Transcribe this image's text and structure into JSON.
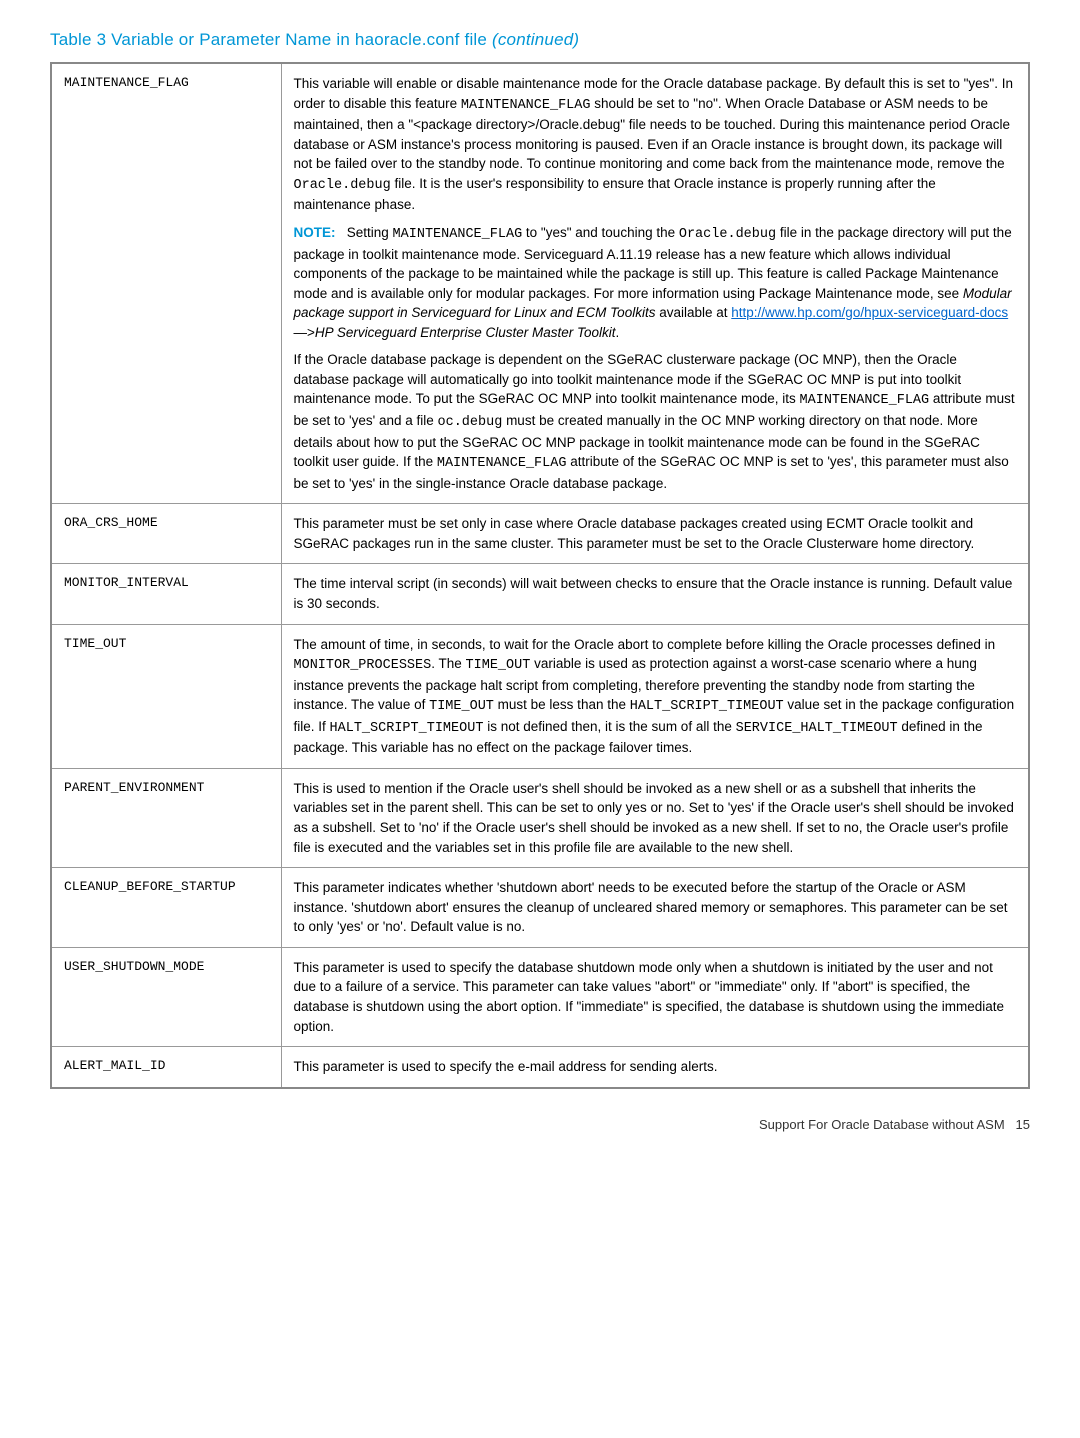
{
  "title_prefix": "Table 3 Variable or Parameter Name in haoracle.conf file ",
  "title_suffix": "(continued)",
  "rows": [
    {
      "param": "MAINTENANCE_FLAG",
      "para1_a": "This variable will enable or disable maintenance mode for the Oracle database package. By default this is set to \"yes\". In order to disable this feature ",
      "para1_b": "MAINTENANCE_FLAG",
      "para1_c": " should be set to \"no\". When Oracle Database or ASM needs to be maintained, then a \"<package directory>/Oracle.debug\" file needs to be touched. During this maintenance period Oracle database or ASM instance's process monitoring is paused. Even if an Oracle instance is brought down, its package will not be failed over to the standby node. To continue monitoring and come back from the maintenance mode, remove the ",
      "para1_d": "Oracle.debug",
      "para1_e": " file. It is the user's responsibility to ensure that Oracle instance is properly running after the maintenance phase.",
      "note_label": "NOTE:",
      "para2_a": "Setting ",
      "para2_b": "MAINTENANCE_FLAG",
      "para2_c": " to \"yes\" and touching the ",
      "para2_d": "Oracle.debug",
      "para2_e": " file in the package directory will put the package in toolkit maintenance mode. Serviceguard A.11.19 release has a new feature which allows individual components of the package to be maintained while the package is still up. This feature is called Package Maintenance mode and is available only for modular packages. For more information using Package Maintenance mode, see ",
      "para2_f": "Modular package support in Serviceguard for Linux and ECM Toolkits",
      "para2_g": " available at ",
      "link1": "http://www.hp.com/go/hpux-serviceguard-docs",
      "para2_h": " —>",
      "para2_i": "HP Serviceguard Enterprise Cluster Master Toolkit",
      "para2_j": ".",
      "para3_a": "If the Oracle database package is dependent on the SGeRAC clusterware package (OC MNP), then the Oracle database package will automatically go into toolkit maintenance mode if the SGeRAC OC MNP is put into toolkit maintenance mode. To put the SGeRAC OC MNP into toolkit maintenance mode, its ",
      "para3_b": "MAINTENANCE_FLAG",
      "para3_c": " attribute must be set to 'yes' and a file ",
      "para3_d": "oc.debug",
      "para3_e": " must be created manually in the OC MNP working directory on that node. More details about how to put the SGeRAC OC MNP package in toolkit maintenance mode can be found in the SGeRAC toolkit user guide. If the ",
      "para3_f": "MAINTENANCE_FLAG",
      "para3_g": " attribute of the SGeRAC OC MNP is set to 'yes', this parameter must also be set to 'yes' in the single-instance Oracle database package."
    },
    {
      "param": "ORA_CRS_HOME",
      "desc": "This parameter must be set only in case where Oracle database packages created using ECMT Oracle toolkit and SGeRAC packages run in the same cluster. This parameter must be set to the Oracle Clusterware home directory."
    },
    {
      "param": "MONITOR_INTERVAL",
      "desc": "The time interval script (in seconds) will wait between checks to ensure that the Oracle instance is running. Default value is 30 seconds."
    },
    {
      "param": "TIME_OUT",
      "p1_a": "The amount of time, in seconds, to wait for the Oracle abort to complete before killing the Oracle processes defined in ",
      "p1_b": "MONITOR_PROCESSES",
      "p1_c": ". The ",
      "p1_d": "TIME_OUT",
      "p1_e": " variable is used as protection against a worst-case scenario where a hung instance prevents the package halt script from completing, therefore preventing the standby node from starting the instance. The value of ",
      "p1_f": "TIME_OUT",
      "p1_g": " must be less than the ",
      "p1_h": "HALT_SCRIPT_TIMEOUT",
      "p1_i": " value set in the package configuration file. If ",
      "p1_j": "HALT_SCRIPT_TIMEOUT",
      "p1_k": " is not defined then, it is the sum of all the ",
      "p1_l": "SERVICE_HALT_TIMEOUT",
      "p1_m": " defined in the package. This variable has no effect on the package failover times."
    },
    {
      "param": "PARENT_ENVIRONMENT",
      "desc": "This is used to mention if the Oracle user's shell should be invoked as a new shell or as a subshell that inherits the variables set in the parent shell. This can be set to only yes or no. Set to 'yes' if the Oracle user's shell should be invoked as a subshell. Set to 'no' if the Oracle user's shell should be invoked as a new shell. If set to no, the Oracle user's profile file is executed and the variables set in this profile file are available to the new shell."
    },
    {
      "param": "CLEANUP_BEFORE_STARTUP",
      "desc": "This parameter indicates whether 'shutdown abort' needs to be executed before the startup of the Oracle or ASM instance. 'shutdown abort' ensures the cleanup of uncleared shared memory or semaphores. This parameter can be set to only 'yes' or 'no'. Default value is no."
    },
    {
      "param": "USER_SHUTDOWN_MODE",
      "desc": "This parameter is used to specify the database shutdown mode only when a shutdown is initiated by the user and not due to a failure of a service. This parameter can take values \"abort\" or \"immediate\" only. If \"abort\" is specified, the database is shutdown using the abort option. If \"immediate\" is specified, the database is shutdown using the immediate option."
    },
    {
      "param": "ALERT_MAIL_ID",
      "desc": "This parameter is used to specify the e-mail address for sending alerts."
    }
  ],
  "footer_text": "Support For Oracle Database without ASM",
  "page_num": "15"
}
